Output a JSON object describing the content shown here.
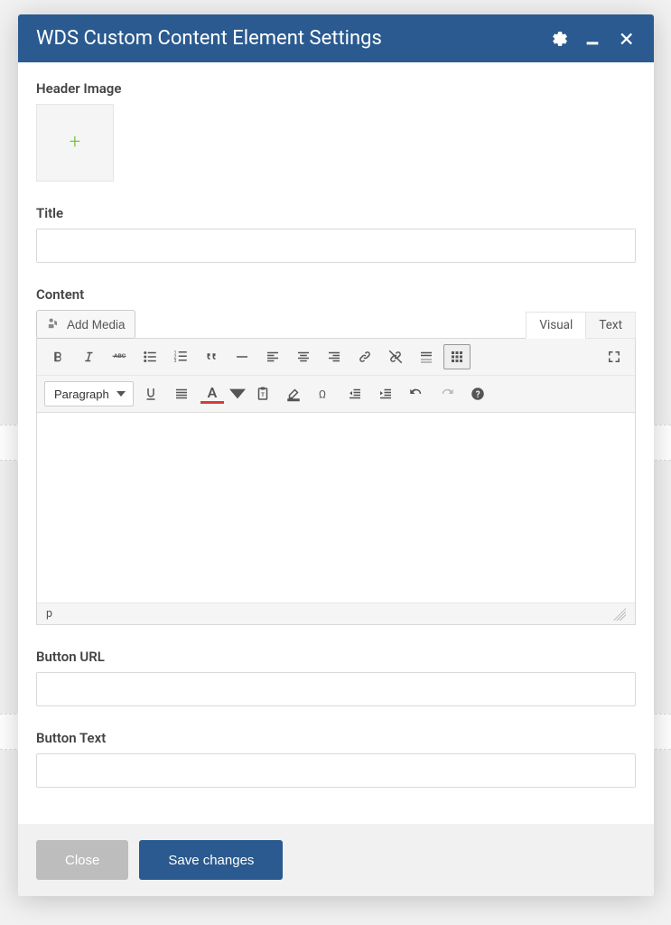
{
  "modal": {
    "title": "WDS Custom Content Element Settings",
    "header_icons": {
      "settings": "gear",
      "minimize": "minimize",
      "close": "close"
    }
  },
  "fields": {
    "header_image_label": "Header Image",
    "title_label": "Title",
    "title_value": "",
    "content_label": "Content",
    "button_url_label": "Button URL",
    "button_url_value": "",
    "button_text_label": "Button Text",
    "button_text_value": ""
  },
  "editor": {
    "add_media_label": "Add Media",
    "tabs": {
      "visual": "Visual",
      "text": "Text",
      "active": "visual"
    },
    "format_selected": "Paragraph",
    "status_path": "p",
    "content_value": "",
    "toolbar_row1": [
      "bold",
      "italic",
      "strikethrough",
      "bulleted-list",
      "numbered-list",
      "blockquote",
      "horizontal-rule",
      "align-left",
      "align-center",
      "align-right",
      "link",
      "unlink",
      "insert-more",
      "toolbar-toggle",
      "fullscreen"
    ],
    "toolbar_row2": [
      "format-select",
      "underline",
      "justify",
      "text-color",
      "text-color-picker",
      "paste-text",
      "clear-formatting",
      "special-character",
      "outdent",
      "indent",
      "undo",
      "redo",
      "help"
    ]
  },
  "footer": {
    "close_label": "Close",
    "save_label": "Save changes"
  },
  "colors": {
    "header_bg": "#2a5a8f",
    "primary_btn": "#2a5a8f",
    "close_btn": "#bdbdbd",
    "plus_icon": "#7bc143",
    "text_color_underline": "#d93b3b"
  }
}
